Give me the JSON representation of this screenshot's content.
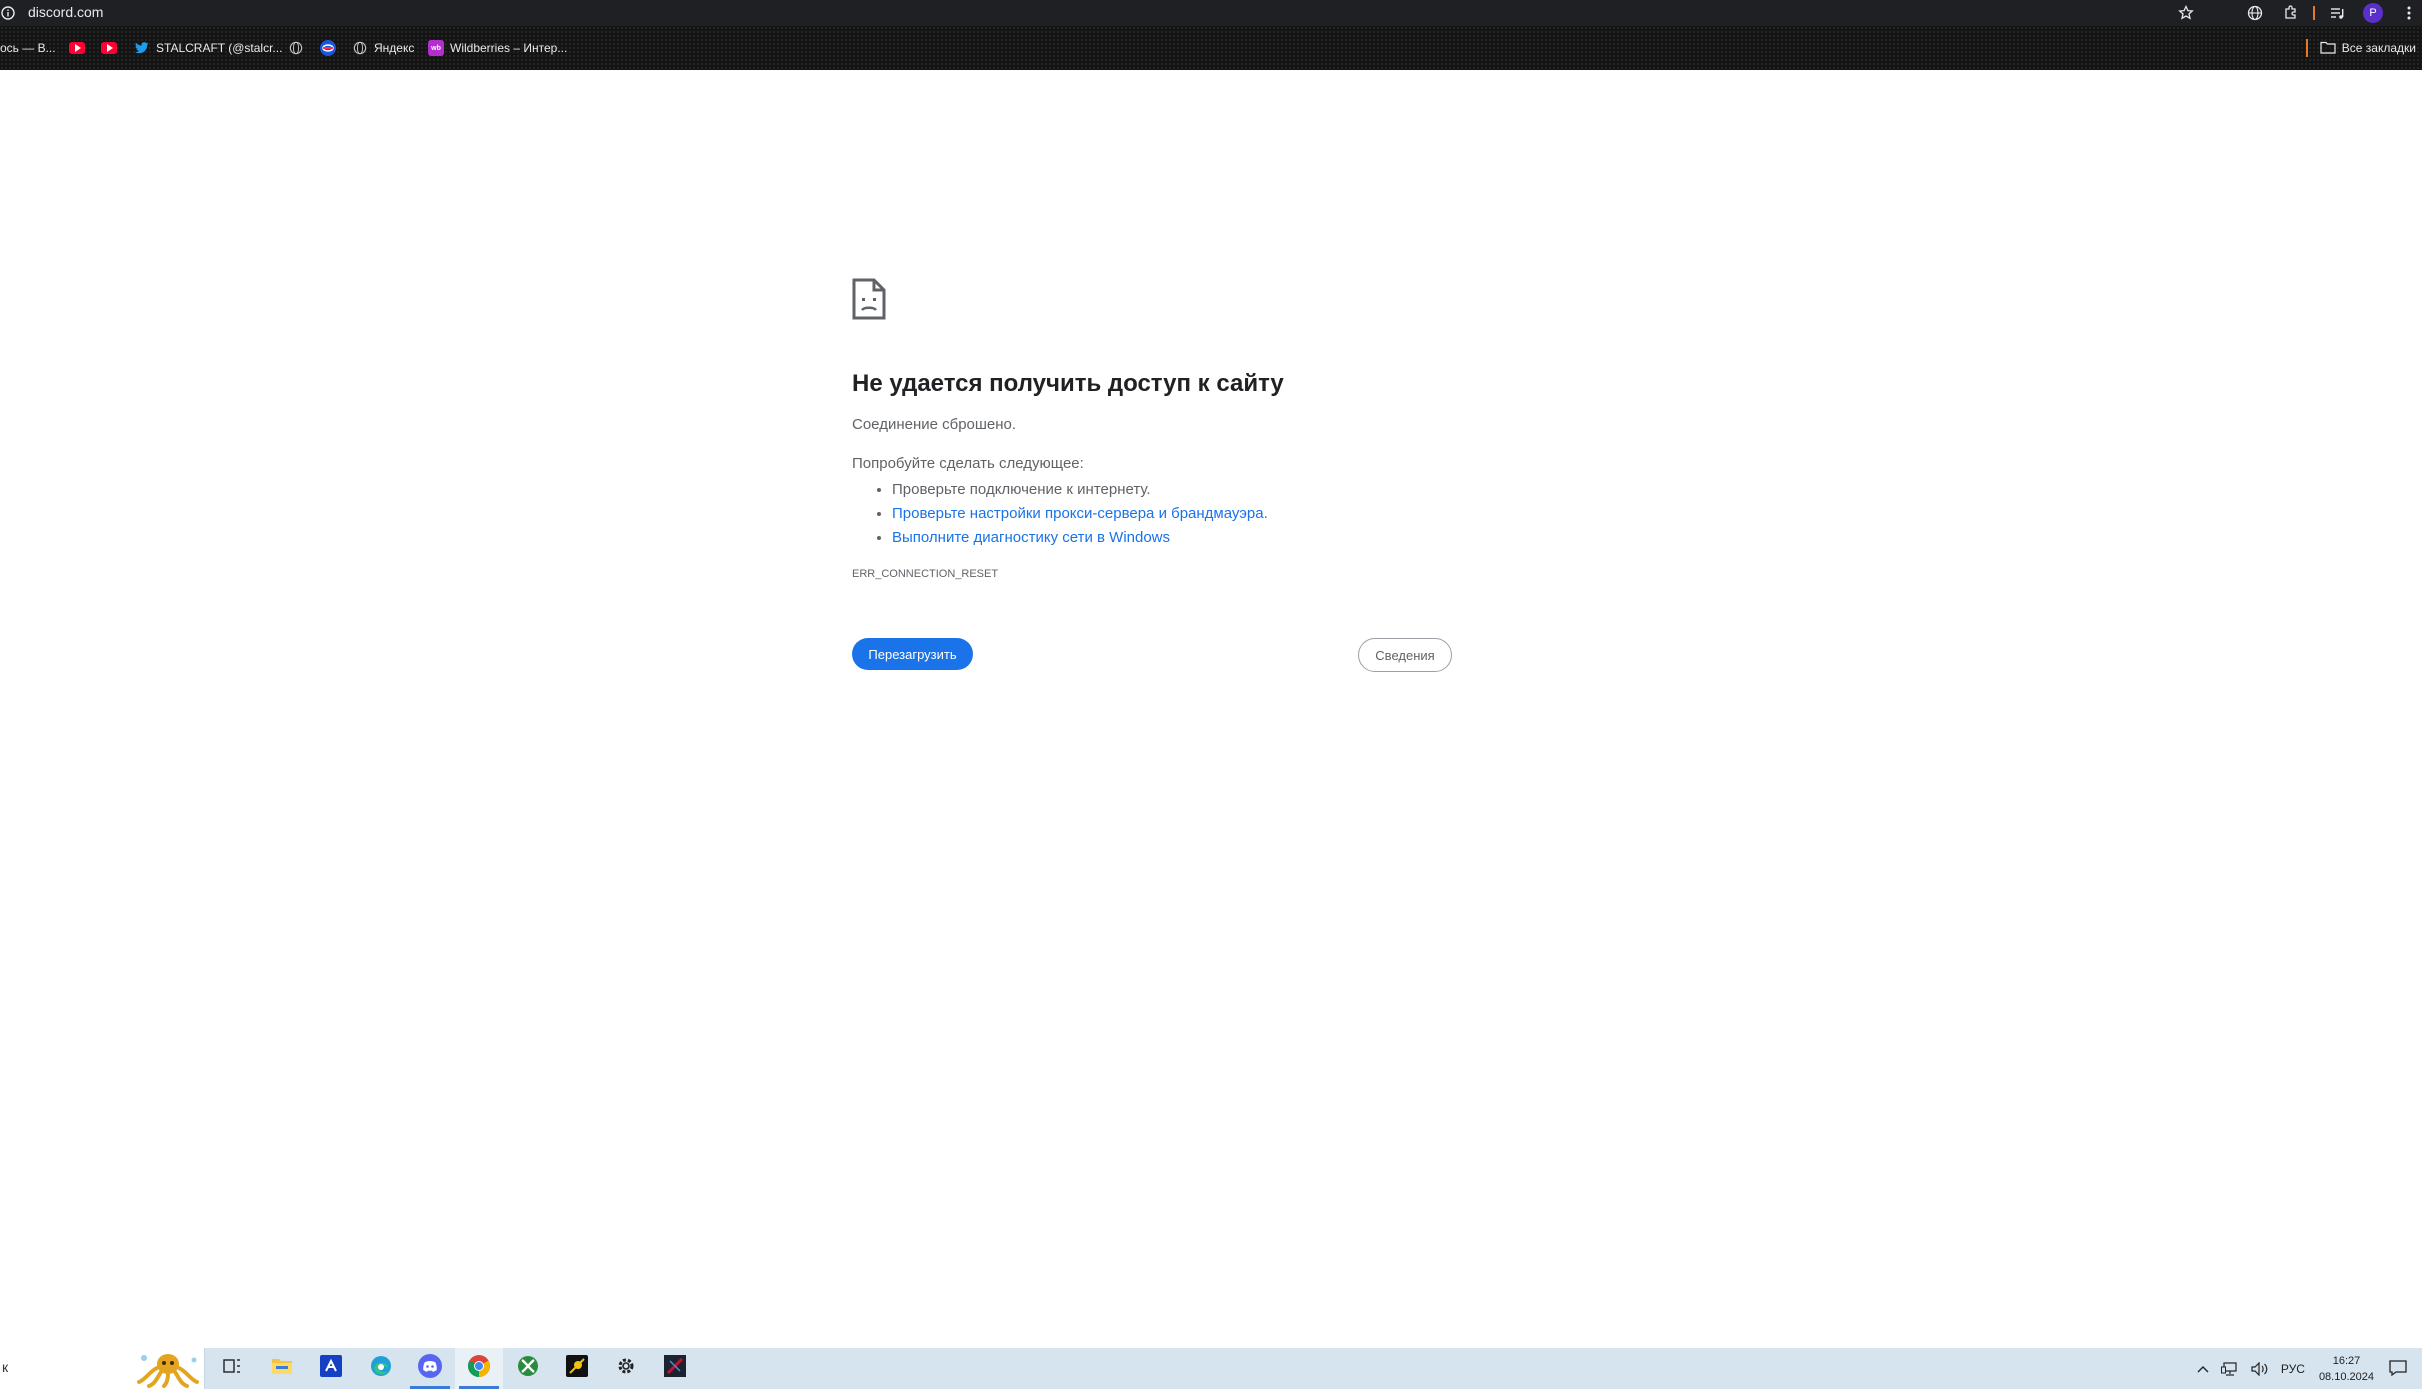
{
  "browser": {
    "url": "discord.com",
    "bookmarks": [
      {
        "label": "ось — В...",
        "icon": "generic"
      },
      {
        "label": "",
        "icon": "youtube-icon"
      },
      {
        "label": "",
        "icon": "youtube-icon"
      },
      {
        "label": "STALCRAFT (@stalcr...",
        "icon": "twitter-icon"
      },
      {
        "label": "",
        "icon": "globe-icon"
      },
      {
        "label": "",
        "icon": "app-icon"
      },
      {
        "label": "Яндекс",
        "icon": "globe-icon"
      },
      {
        "label": "Wildberries – Интер...",
        "icon": "wildberries-icon"
      }
    ],
    "all_bookmarks_label": "Все закладки",
    "profile_initial": "P"
  },
  "error_page": {
    "title": "Не удается получить доступ к сайту",
    "subtitle": "Соединение сброшено.",
    "try_label": "Попробуйте сделать следующее:",
    "suggestions": [
      {
        "text": "Проверьте подключение к интернету.",
        "link": false
      },
      {
        "text": "Проверьте настройки прокси-сервера и брандмауэра.",
        "link": true
      },
      {
        "text": "Выполните диагностику сети в Windows",
        "link": true
      }
    ],
    "error_code": "ERR_CONNECTION_RESET",
    "reload_label": "Перезагрузить",
    "details_label": "Сведения"
  },
  "taskbar": {
    "search_text": "к",
    "apps": [
      "task-view-icon",
      "file-explorer-icon",
      "app-store-icon",
      "edge-icon",
      "discord-icon",
      "chrome-icon",
      "xbox-icon",
      "app-icon",
      "settings-icon",
      "game-icon"
    ],
    "language": "РУС",
    "time": "16:27",
    "date": "08.10.2024"
  },
  "colors": {
    "accent_blue": "#1a73e8",
    "chrome_dark": "#1f2023",
    "taskbar_bg": "#d5e4ee"
  }
}
